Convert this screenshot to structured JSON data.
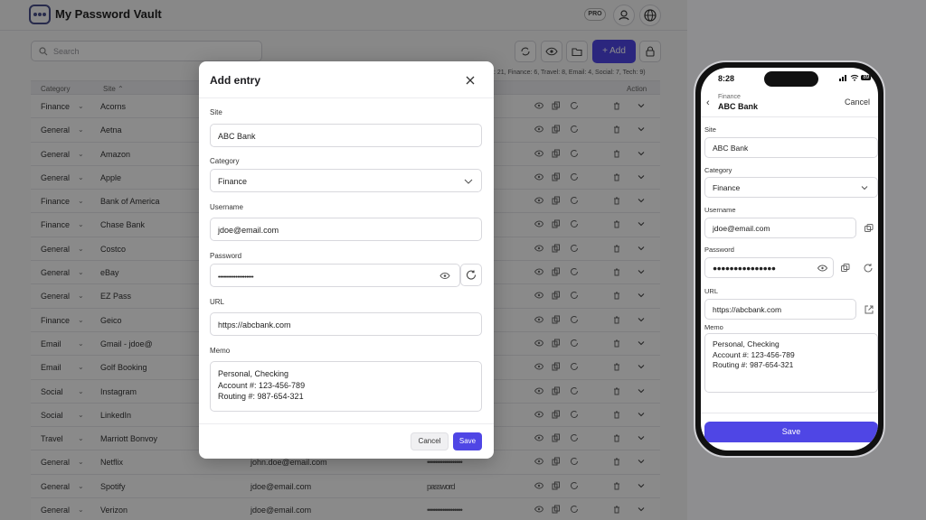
{
  "app": {
    "title": "My Password Vault",
    "pro_badge": "PRO",
    "search_placeholder": "Search",
    "add_label": "+ Add",
    "counts": ": 21, Finance: 6, Travel: 8, Email: 4, Social: 7, Tech: 9)",
    "columns": {
      "category": "Category",
      "site": "Site ⌃",
      "action": "Action"
    },
    "rows": [
      {
        "category": "Finance",
        "site": "Acorns",
        "username": "",
        "password": ""
      },
      {
        "category": "General",
        "site": "Aetna",
        "username": "",
        "password": ""
      },
      {
        "category": "General",
        "site": "Amazon",
        "username": "",
        "password": ""
      },
      {
        "category": "General",
        "site": "Apple",
        "username": "",
        "password": ""
      },
      {
        "category": "Finance",
        "site": "Bank of America",
        "username": "",
        "password": ""
      },
      {
        "category": "Finance",
        "site": "Chase Bank",
        "username": "",
        "password": ""
      },
      {
        "category": "General",
        "site": "Costco",
        "username": "",
        "password": ""
      },
      {
        "category": "General",
        "site": "eBay",
        "username": "",
        "password": ""
      },
      {
        "category": "General",
        "site": "EZ Pass",
        "username": "",
        "password": ""
      },
      {
        "category": "Finance",
        "site": "Geico",
        "username": "",
        "password": ""
      },
      {
        "category": "Email",
        "site": "Gmail - jdoe@",
        "username": "",
        "password": ""
      },
      {
        "category": "Email",
        "site": "Golf Booking",
        "username": "",
        "password": ""
      },
      {
        "category": "Social",
        "site": "Instagram",
        "username": "",
        "password": ""
      },
      {
        "category": "Social",
        "site": "LinkedIn",
        "username": "",
        "password": ""
      },
      {
        "category": "Travel",
        "site": "Marriott Bonvoy",
        "username": "",
        "password": ""
      },
      {
        "category": "General",
        "site": "Netflix",
        "username": "john.doe@email.com",
        "password": "••••••••••••••••••"
      },
      {
        "category": "General",
        "site": "Spotify",
        "username": "jdoe@email.com",
        "password": "password"
      },
      {
        "category": "General",
        "site": "Verizon",
        "username": "jdoe@email.com",
        "password": "••••••••••••••••••"
      }
    ]
  },
  "modal": {
    "title": "Add entry",
    "site_label": "Site",
    "site_value": "ABC Bank",
    "category_label": "Category",
    "category_value": "Finance",
    "username_label": "Username",
    "username_value": "jdoe@email.com",
    "password_label": "Password",
    "password_value": "••••••••••••••••••••",
    "url_label": "URL",
    "url_value": "https://abcbank.com",
    "memo_label": "Memo",
    "memo_lines": [
      "Personal, Checking",
      "Account #: 123-456-789",
      "Routing #: 987-654-321"
    ],
    "cancel_label": "Cancel",
    "save_label": "Save"
  },
  "phone": {
    "time": "8:28",
    "battery": "89",
    "header_subtitle": "Finance",
    "header_title": "ABC Bank",
    "cancel_label": "Cancel",
    "site_label": "Site",
    "site_value": "ABC Bank",
    "category_label": "Category",
    "category_value": "Finance",
    "username_label": "Username",
    "username_value": "jdoe@email.com",
    "password_label": "Password",
    "password_value": "●●●●●●●●●●●●●●●",
    "url_label": "URL",
    "url_value": "https://abcbank.com",
    "memo_label": "Memo",
    "memo_lines": [
      "Personal, Checking",
      "Account #: 123-456-789",
      "Routing #: 987-654-321"
    ],
    "save_label": "Save"
  },
  "colors": {
    "accent": "#4f46e5",
    "overlay": "#8b8b8d"
  }
}
